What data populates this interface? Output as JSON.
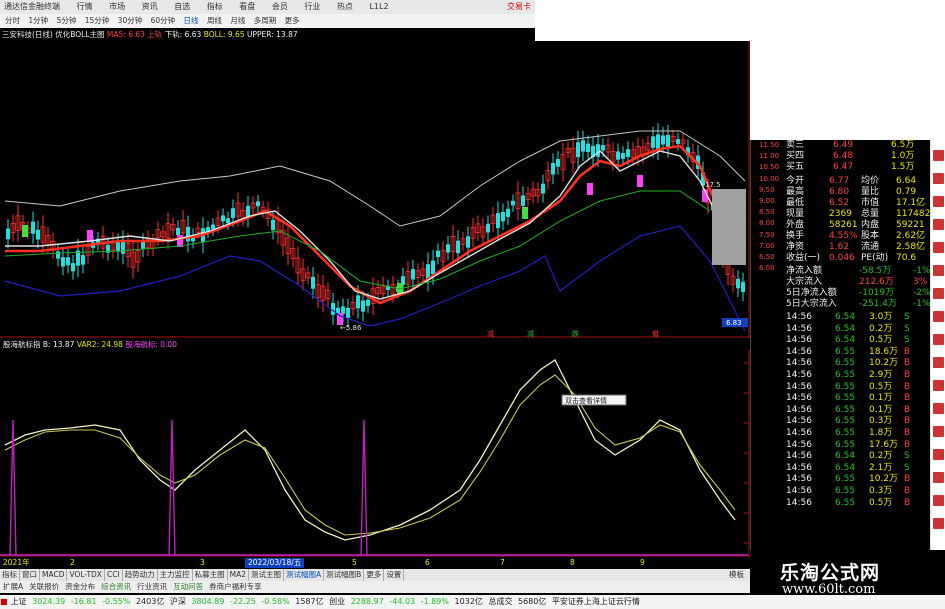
{
  "titlebar": {
    "items": [
      "通达信金融终端",
      "行情",
      "市场",
      "资讯",
      "自选",
      "指标",
      "看盘",
      "会员",
      "行业",
      "热点",
      "L1L2"
    ],
    "trade": "交易卡"
  },
  "toolbar": {
    "periods": [
      "分时",
      "1分钟",
      "5分钟",
      "15分钟",
      "30分钟",
      "60分钟",
      "日线",
      "周线",
      "月线",
      "多周期",
      "更多"
    ],
    "active": "日线"
  },
  "infobar": {
    "stock": "三安科技(日线)",
    "template": "优化BOLL主图",
    "ma": "MA5: 6.63",
    "up": "上轨",
    "down": "下轨: 6.63",
    "boll": "BOLL: 9.65",
    "upper": "UPPER: 13.87"
  },
  "price_axis": [
    "11.50",
    "11.00",
    "10.50",
    "10.00",
    "9.50",
    "9.00",
    "8.50",
    "8.00",
    "7.50",
    "7.00",
    "6.50",
    "6.00"
  ],
  "price_labels": {
    "low": "5.86",
    "high": "17.5",
    "last": "6.83"
  },
  "chart_markers": [
    "减",
    "跌",
    "撤"
  ],
  "quote": {
    "book": [
      {
        "label": "卖三",
        "price": "6.49",
        "vol": "6.5万"
      },
      {
        "label": "买四",
        "price": "6.48",
        "vol": "1.0万"
      },
      {
        "label": "买五",
        "price": "6.47",
        "vol": "1.5万"
      }
    ],
    "stats": [
      {
        "l1": "今开",
        "v1": "6.77",
        "l2": "均价",
        "v2": "6.64"
      },
      {
        "l1": "最高",
        "v1": "6.80",
        "l2": "量比",
        "v2": "0.79"
      },
      {
        "l1": "最低",
        "v1": "6.52",
        "l2": "市值",
        "v2": "17.1亿"
      },
      {
        "l1": "现量",
        "v1": "2369",
        "l2": "总量",
        "v2": "117482"
      },
      {
        "l1": "外盘",
        "v1": "58261",
        "l2": "内盘",
        "v2": "59221"
      },
      {
        "l1": "换手",
        "v1": "4.55%",
        "l2": "股本",
        "v2": "2.62亿"
      },
      {
        "l1": "净资",
        "v1": "1.62",
        "l2": "流通",
        "v2": "2.58亿"
      },
      {
        "l1": "收益(一)",
        "v1": "0.046",
        "l2": "PE(动)",
        "v2": "70.6"
      }
    ],
    "flows": [
      {
        "label": "净流入额",
        "value": "-58.5万",
        "pct": "-1%"
      },
      {
        "label": "大宗流入",
        "value": "212.6万",
        "pct": "3%"
      },
      {
        "label": "5日净流入额",
        "value": "-1019万",
        "pct": "-2%"
      },
      {
        "label": "5日大宗流入",
        "value": "-251.4万",
        "pct": "-1%"
      }
    ],
    "ticks": [
      {
        "t": "14:56",
        "p": "6.54",
        "v": "3.0万",
        "s": "S"
      },
      {
        "t": "14:56",
        "p": "6.54",
        "v": "0.2万",
        "s": "S"
      },
      {
        "t": "14:56",
        "p": "6.54",
        "v": "0.5万",
        "s": "S"
      },
      {
        "t": "14:56",
        "p": "6.55",
        "v": "18.6万",
        "s": "B"
      },
      {
        "t": "14:56",
        "p": "6.55",
        "v": "10.2万",
        "s": "B"
      },
      {
        "t": "14:56",
        "p": "6.55",
        "v": "2.9万",
        "s": "B"
      },
      {
        "t": "14:56",
        "p": "6.55",
        "v": "0.5万",
        "s": "B"
      },
      {
        "t": "14:56",
        "p": "6.55",
        "v": "0.1万",
        "s": "B"
      },
      {
        "t": "14:56",
        "p": "6.55",
        "v": "0.1万",
        "s": "B"
      },
      {
        "t": "14:56",
        "p": "6.55",
        "v": "0.3万",
        "s": "B"
      },
      {
        "t": "14:56",
        "p": "6.55",
        "v": "1.8万",
        "s": "B"
      },
      {
        "t": "14:56",
        "p": "6.55",
        "v": "17.6万",
        "s": "B"
      },
      {
        "t": "14:56",
        "p": "6.54",
        "v": "0.2万",
        "s": "S"
      },
      {
        "t": "14:56",
        "p": "6.54",
        "v": "2.1万",
        "s": "S"
      },
      {
        "t": "14:56",
        "p": "6.55",
        "v": "10.2万",
        "s": "B"
      },
      {
        "t": "14:56",
        "p": "6.55",
        "v": "0.3万",
        "s": "B"
      },
      {
        "t": "14:56",
        "p": "6.55",
        "v": "0.5万",
        "s": "B"
      }
    ]
  },
  "indicator": {
    "name": "股海航标指 B: 13.87",
    "var": "VAR2: 24.98",
    "label": "股海航标: 0.00",
    "axis": [
      "70.00",
      "60.00",
      "50.00",
      "40.00",
      "30.00",
      "20.00",
      "10.00"
    ],
    "tooltip": "双击查看详情"
  },
  "datebar": {
    "year": "2021年",
    "date": "2022/03/18/五",
    "marks": [
      "2",
      "3",
      "5",
      "6",
      "7",
      "8",
      "9"
    ]
  },
  "tabs": [
    "指标",
    "窗口",
    "MACD",
    "VOL-TDX",
    "CCI",
    "趋势动力",
    "主力监控",
    "私募主图",
    "MA2",
    "测试主图",
    "测试幅图A",
    "测试幅图B",
    "更多",
    "设置"
  ],
  "tabs_active": "测试幅图A",
  "tabs_right": "模板",
  "tabs2": [
    "扩展A",
    "关联报价",
    "资金分布",
    "综合资讯",
    "行业资讯",
    "互动问答",
    "券商户福利专享"
  ],
  "brand": {
    "name": "乐淘公式网",
    "url": "www.60lt.com"
  },
  "ticker": [
    {
      "name": "上证",
      "val": "3024.39",
      "chg": "-16.81",
      "pct": "-0.55%",
      "amt": "2403亿"
    },
    {
      "name": "沪深",
      "val": "3804.89",
      "chg": "-22.25",
      "pct": "-0.58%",
      "amt": "1587亿"
    },
    {
      "name": "创业",
      "val": "2288.97",
      "chg": "-44.03",
      "pct": "-1.89%",
      "amt": "1032亿"
    }
  ],
  "ticker_total": {
    "label": "总成交",
    "amt": "5680亿",
    "broker": "平安证券上海上证云行情"
  },
  "colors": {
    "up": "#ff3030",
    "down": "#20e0e0",
    "ma_red": "#ff3020",
    "upper": "#c8c8c8",
    "lower": "#2020c0",
    "k": "#f0f0c0",
    "d": "#c8c850",
    "spike": "#c020c0"
  }
}
